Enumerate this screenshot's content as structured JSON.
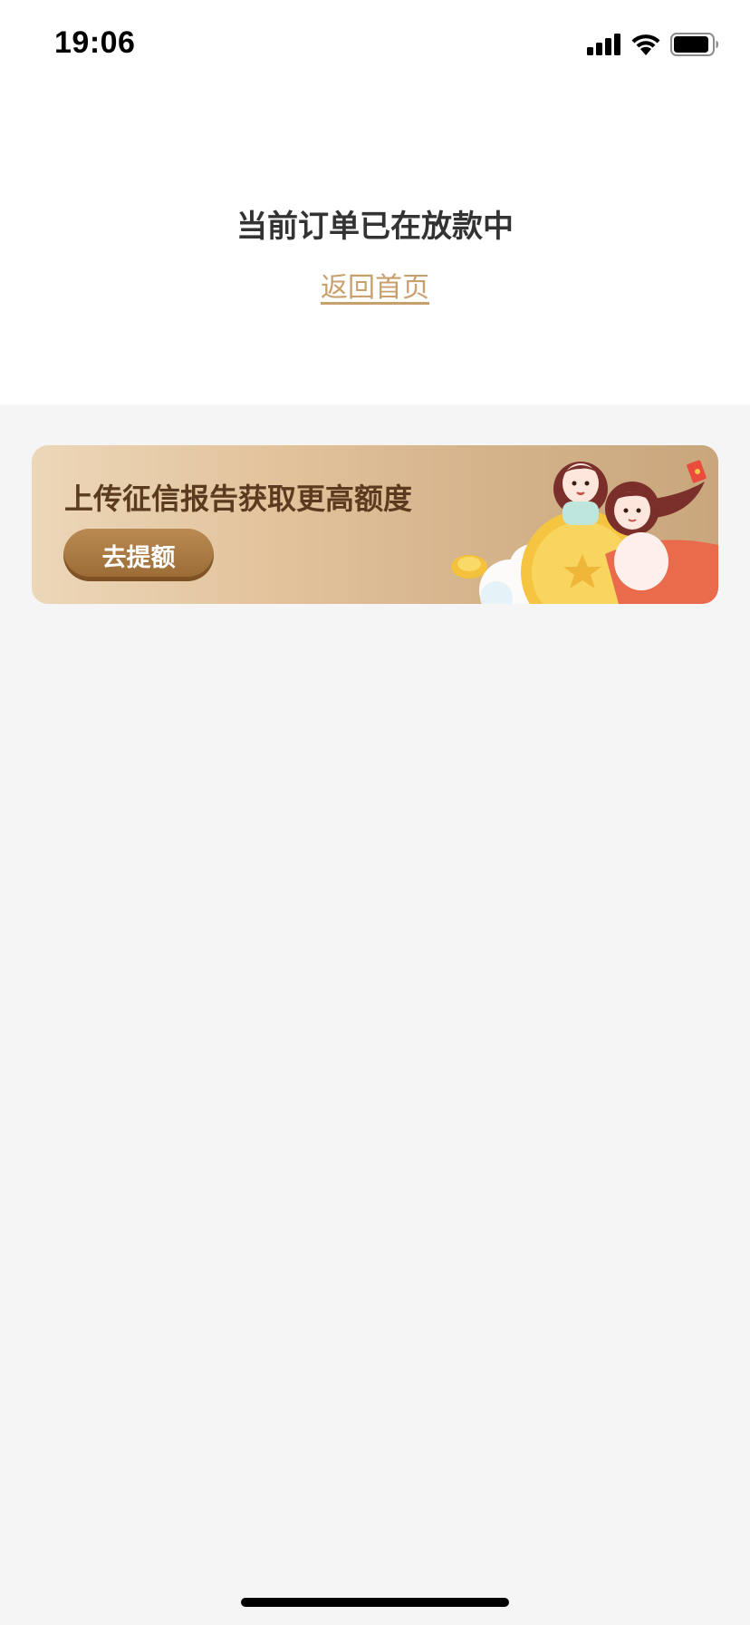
{
  "status_bar": {
    "time": "19:06",
    "icons": [
      "signal-icon",
      "wifi-icon",
      "battery-icon"
    ]
  },
  "result": {
    "title": "当前订单已在放款中",
    "back_link_label": "返回首页"
  },
  "banner": {
    "text": "上传征信报告获取更高额度",
    "button_label": "去提额",
    "illustration": "girls-with-gold-coin-illustration"
  },
  "colors": {
    "title": "#333333",
    "link": "#c8a06e",
    "banner_text": "#5b3b1f",
    "button": "#a8773f",
    "background": "#f5f5f5"
  }
}
